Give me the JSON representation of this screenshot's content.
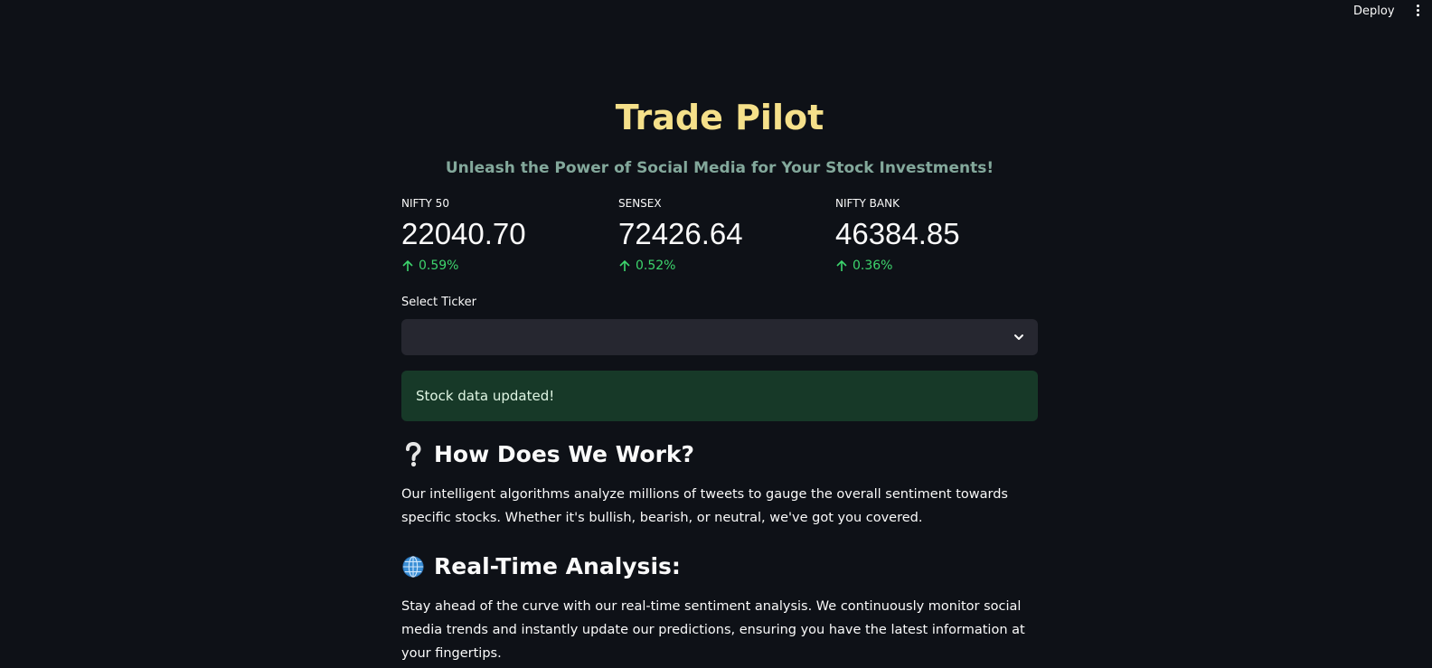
{
  "topbar": {
    "deploy_label": "Deploy"
  },
  "header": {
    "title": "Trade Pilot",
    "subtitle": "Unleash the Power of Social Media for Your Stock Investments!"
  },
  "metrics": [
    {
      "label": "NIFTY 50",
      "value": "22040.70",
      "delta": "0.59%"
    },
    {
      "label": "SENSEX",
      "value": "72426.64",
      "delta": "0.52%"
    },
    {
      "label": "NIFTY BANK",
      "value": "46384.85",
      "delta": "0.36%"
    }
  ],
  "ticker_select": {
    "label": "Select Ticker",
    "value": ""
  },
  "alert": {
    "message": "Stock data updated!"
  },
  "sections": [
    {
      "icon": "question-mark-icon",
      "heading": "How Does We Work?",
      "body": "Our intelligent algorithms analyze millions of tweets to gauge the overall sentiment towards specific stocks. Whether it's bullish, bearish, or neutral, we've got you covered."
    },
    {
      "icon": "globe-icon",
      "heading": "Real-Time Analysis:",
      "body": "Stay ahead of the curve with our real-time sentiment analysis. We continuously monitor social media trends and instantly update our predictions, ensuring you have the latest information at your fingertips."
    }
  ],
  "colors": {
    "background": "#0e1117",
    "title": "#f5e08a",
    "subtitle": "#83a89b",
    "positive_delta": "#3dd56d",
    "select_bg": "#262730",
    "success_alert_bg": "#173928"
  }
}
